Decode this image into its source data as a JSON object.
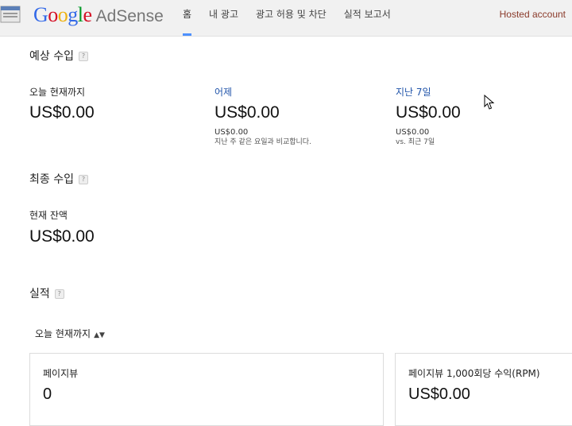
{
  "header": {
    "logo_google": "Google",
    "logo_adsense": "AdSense",
    "tabs": [
      {
        "label": "홈",
        "active": true
      },
      {
        "label": "내 광고",
        "active": false
      },
      {
        "label": "광고 허용 및 차단",
        "active": false
      },
      {
        "label": "실적 보고서",
        "active": false
      }
    ],
    "account": "Hosted account"
  },
  "estimated": {
    "title": "예상 수입",
    "help": "?",
    "today": {
      "label": "오늘 현재까지",
      "value": "US$0.00"
    },
    "yesterday": {
      "label": "어제",
      "value": "US$0.00",
      "compare_value": "US$0.00",
      "compare_note": "지난 주 같은 요일과 비교합니다."
    },
    "last7": {
      "label": "지난 7일",
      "value": "US$0.00",
      "compare_value": "US$0.00",
      "compare_note": "vs. 최근 7일"
    }
  },
  "finalized": {
    "title": "최종 수입",
    "help": "?",
    "balance_label": "현재 잔액",
    "balance_value": "US$0.00"
  },
  "performance": {
    "title": "실적",
    "help": "?",
    "range_selected": "오늘 현재까지",
    "cards": [
      {
        "label": "페이지뷰",
        "value": "0"
      },
      {
        "label": "페이지뷰 1,000회당 수익(RPM)",
        "value": "US$0.00"
      }
    ]
  },
  "colors": {
    "accent": "#4d90fe",
    "link": "#2255aa",
    "account": "#8a3a2a"
  }
}
